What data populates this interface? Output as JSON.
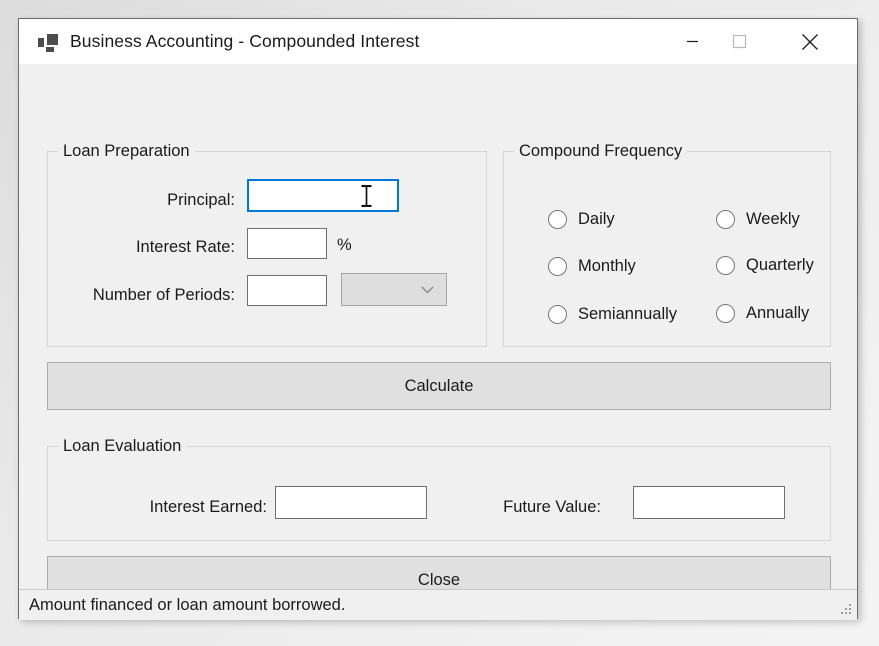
{
  "window": {
    "title": "Business Accounting - Compounded Interest",
    "app_icon": "windows-forms-app-icon",
    "controls": {
      "minimize": "minimize-icon",
      "maximize": "maximize-icon",
      "close": "close-icon"
    }
  },
  "loan_preparation": {
    "legend": "Loan Preparation",
    "principal": {
      "label": "Principal:",
      "value": "",
      "focused": true
    },
    "interest_rate": {
      "label": "Interest Rate:",
      "value": "",
      "suffix": "%"
    },
    "number_of_periods": {
      "label": "Number of Periods:",
      "value": "",
      "unit_dropdown_value": ""
    }
  },
  "compound_frequency": {
    "legend": "Compound Frequency",
    "options": [
      {
        "label": "Daily",
        "selected": false
      },
      {
        "label": "Weekly",
        "selected": false
      },
      {
        "label": "Monthly",
        "selected": false
      },
      {
        "label": "Quarterly",
        "selected": false
      },
      {
        "label": "Semiannually",
        "selected": false
      },
      {
        "label": "Annually",
        "selected": false
      }
    ]
  },
  "calculate_button": {
    "label": "Calculate"
  },
  "loan_evaluation": {
    "legend": "Loan Evaluation",
    "interest_earned": {
      "label": "Interest Earned:",
      "value": ""
    },
    "future_value": {
      "label": "Future Value:",
      "value": ""
    }
  },
  "close_button": {
    "label": "Close"
  },
  "status_bar": {
    "message": "Amount financed or loan amount borrowed."
  },
  "colors": {
    "form_background": "#f0f0f0",
    "title_bar": "#ffffff",
    "focus_border": "#0078d7",
    "button_face": "#e0e0e0",
    "text": "#1a1a1a"
  }
}
